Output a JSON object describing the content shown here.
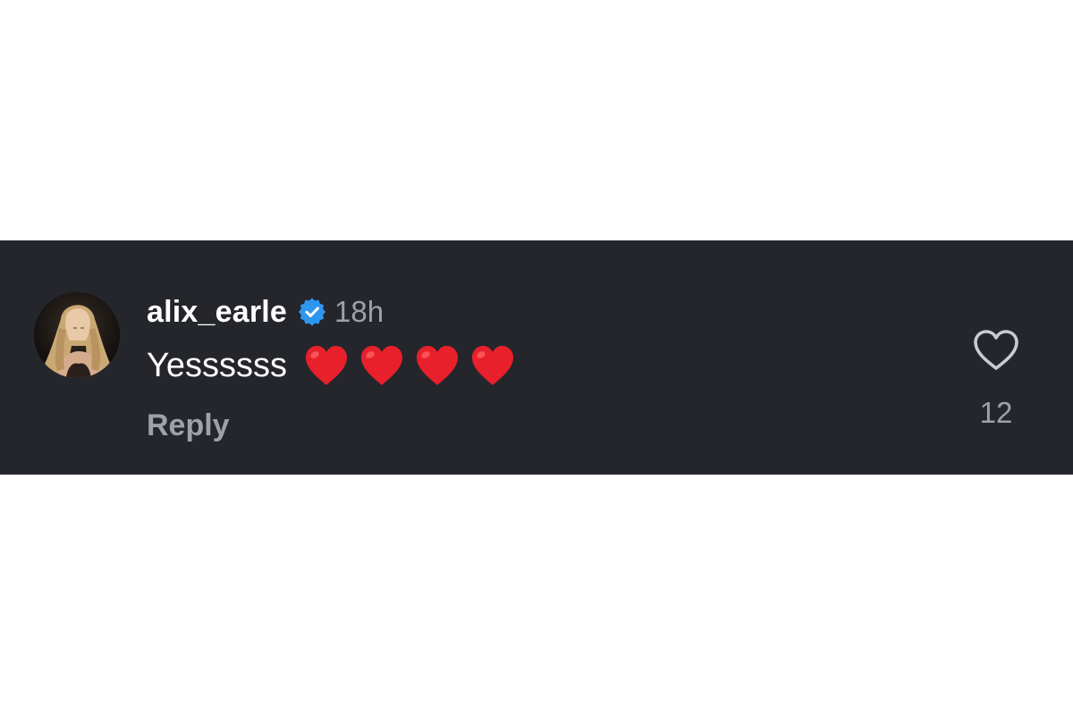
{
  "comment": {
    "username": "alix_earle",
    "verified_icon": "verified-badge-icon",
    "timestamp": "18h",
    "text": "Yessssss",
    "emojis": [
      "red-heart-emoji",
      "red-heart-emoji",
      "red-heart-emoji",
      "red-heart-emoji"
    ],
    "reply_label": "Reply",
    "like_icon": "heart-outline-icon",
    "like_count": "12"
  },
  "colors": {
    "card_background": "#24262c",
    "page_background": "#ffffff",
    "username": "#ffffff",
    "secondary_text": "#9ea1a8",
    "verified_blue": "#2f96f0",
    "heart_red": "#e8202b"
  }
}
